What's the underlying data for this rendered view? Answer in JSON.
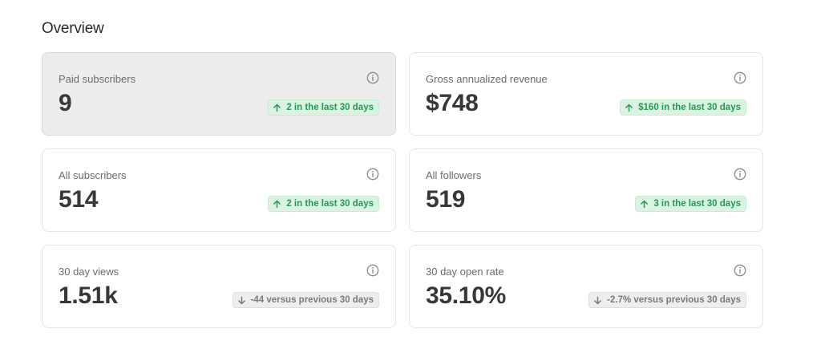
{
  "section": {
    "title": "Overview"
  },
  "colors": {
    "positive": "#1f9c52",
    "positive_bg": "#dcf3e3",
    "neutral": "#7a7a7a",
    "neutral_bg": "#eeeeee",
    "active_card_bg": "#ededed"
  },
  "cards": [
    {
      "label": "Paid subscribers",
      "value": "9",
      "trend": "up",
      "change": "2 in the last 30 days",
      "active": true,
      "icons": [
        "info-icon",
        "arrow-up-icon"
      ]
    },
    {
      "label": "Gross annualized revenue",
      "value": "$748",
      "trend": "up",
      "change": "$160 in the last 30 days",
      "active": false,
      "icons": [
        "info-icon",
        "arrow-up-icon"
      ]
    },
    {
      "label": "All subscribers",
      "value": "514",
      "trend": "up",
      "change": "2 in the last 30 days",
      "active": false,
      "icons": [
        "info-icon",
        "arrow-up-icon"
      ]
    },
    {
      "label": "All followers",
      "value": "519",
      "trend": "up",
      "change": "3 in the last 30 days",
      "active": false,
      "icons": [
        "info-icon",
        "arrow-up-icon"
      ]
    },
    {
      "label": "30 day views",
      "value": "1.51k",
      "trend": "down",
      "change": "-44 versus previous 30 days",
      "active": false,
      "icons": [
        "info-icon",
        "arrow-down-icon"
      ]
    },
    {
      "label": "30 day open rate",
      "value": "35.10%",
      "trend": "down",
      "change": "-2.7% versus previous 30 days",
      "active": false,
      "icons": [
        "info-icon",
        "arrow-down-icon"
      ]
    }
  ]
}
